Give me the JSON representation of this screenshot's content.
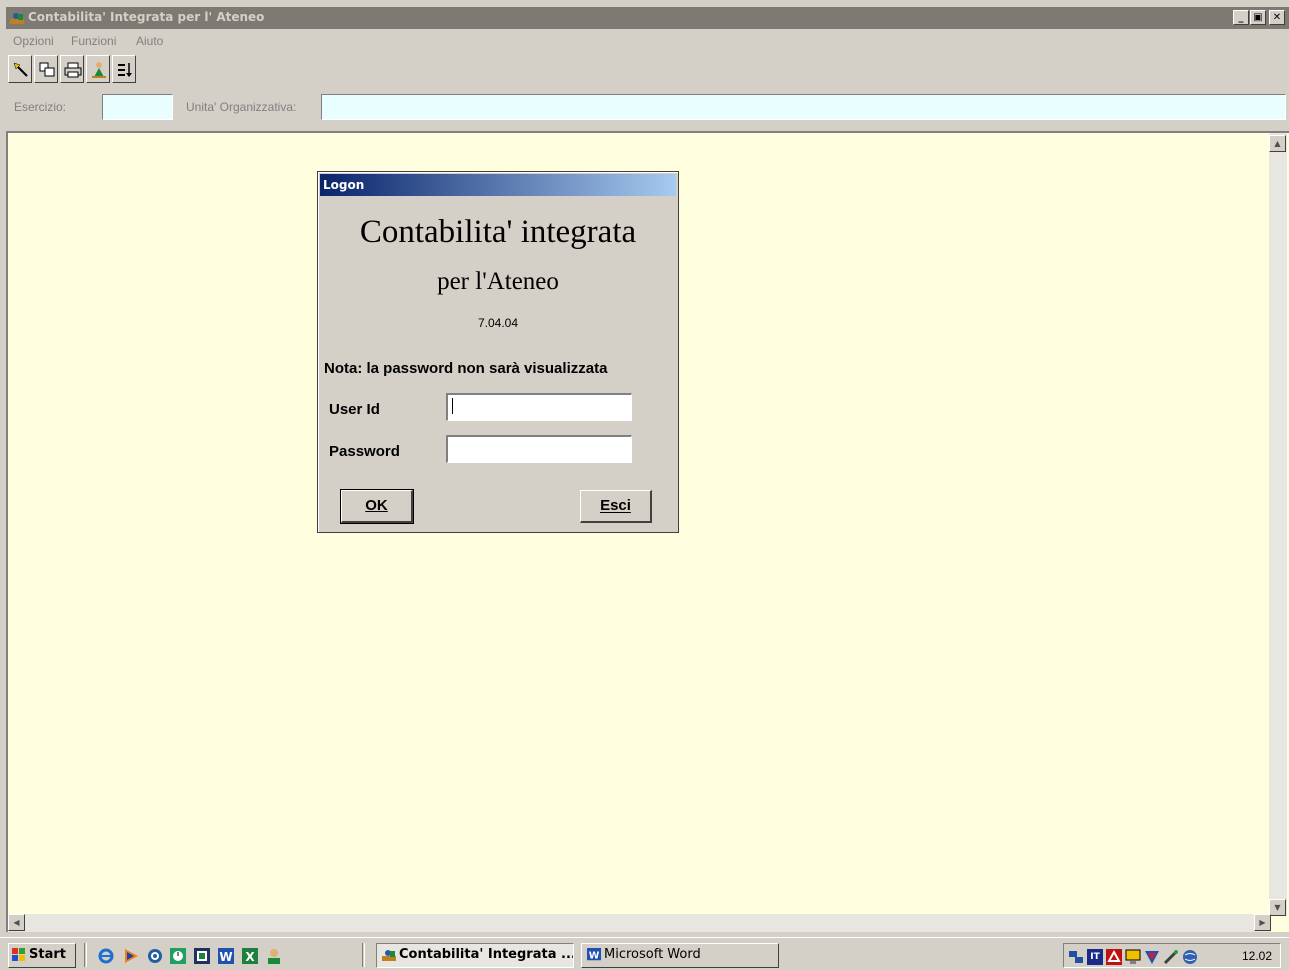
{
  "colors": {
    "titlebar_inactive": "#7d7a74",
    "client_background": "#ffffe0",
    "input_background": "#e9ffff",
    "dialog_title_start": "#0a246a",
    "dialog_title_end": "#a6caf0"
  },
  "window": {
    "title": "Contabilita' Integrata per l' Ateneo",
    "minimize_glyph": "_",
    "maximize_glyph": "▣",
    "close_glyph": "✕"
  },
  "menu": {
    "items": [
      "Opzioni",
      "Funzioni",
      "Aiuto"
    ]
  },
  "toolbar": {
    "buttons": [
      "pointer-icon",
      "copy-windows-icon",
      "print-icon",
      "user-wizard-icon",
      "sort-icon"
    ]
  },
  "filters": {
    "esercizio_label": "Esercizio:",
    "esercizio_value": "",
    "unita_label": "Unita' Organizzativa:",
    "unita_value": ""
  },
  "logon": {
    "title": "Logon",
    "app_name": "Contabilita' integrata",
    "app_subtitle": "per l'Ateneo",
    "version": "7.04.04",
    "note": "Nota: la password non sarà visualizzata",
    "userid_label": "User Id",
    "userid_value": "",
    "password_label": "Password",
    "password_value": "",
    "ok_label": "OK",
    "exit_label": "Esci"
  },
  "taskbar": {
    "start_label": "Start",
    "quick_launch": [
      "ie-icon",
      "media-player-icon",
      "outlook-icon",
      "clock-icon",
      "app-icon",
      "word-icon",
      "excel-icon",
      "user-icon"
    ],
    "tasks": [
      {
        "label": "Contabilita' Integrata ...",
        "icon": "app-icon",
        "active": true
      },
      {
        "label": "Microsoft Word",
        "icon": "word-icon",
        "active": false
      }
    ],
    "tray_icons": [
      "network-icon",
      "language-it-icon",
      "acrobat-icon",
      "monitor-icon",
      "antivirus-icon",
      "tools-icon",
      "globe-icon"
    ],
    "language": "IT",
    "clock": "12.02"
  }
}
